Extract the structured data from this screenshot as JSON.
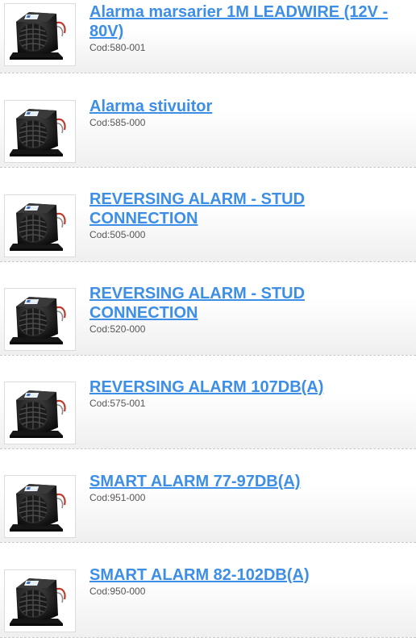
{
  "products": [
    {
      "title": "Alarma marsarier 1M LEADWIRE (12V - 80V)",
      "code": "Cod:580-001",
      "image_icon": "reversing-alarm-icon"
    },
    {
      "title": "Alarma stivuitor",
      "code": "Cod:585-000",
      "image_icon": "reversing-alarm-icon"
    },
    {
      "title": "REVERSING ALARM - STUD CONNECTION",
      "code": "Cod:505-000",
      "image_icon": "reversing-alarm-icon"
    },
    {
      "title": "REVERSING ALARM - STUD CONNECTION",
      "code": "Cod:520-000",
      "image_icon": "reversing-alarm-icon"
    },
    {
      "title": "REVERSING ALARM 107DB(A)",
      "code": "Cod:575-001",
      "image_icon": "reversing-alarm-icon"
    },
    {
      "title": "SMART ALARM 77-97DB(A)",
      "code": "Cod:951-000",
      "image_icon": "reversing-alarm-icon"
    },
    {
      "title": "SMART ALARM 82-102DB(A)",
      "code": "Cod:950-000",
      "image_icon": "reversing-alarm-icon"
    }
  ],
  "colors": {
    "link": "#3c8ee6",
    "code_text": "#555555",
    "divider": "#c9c9c9"
  }
}
